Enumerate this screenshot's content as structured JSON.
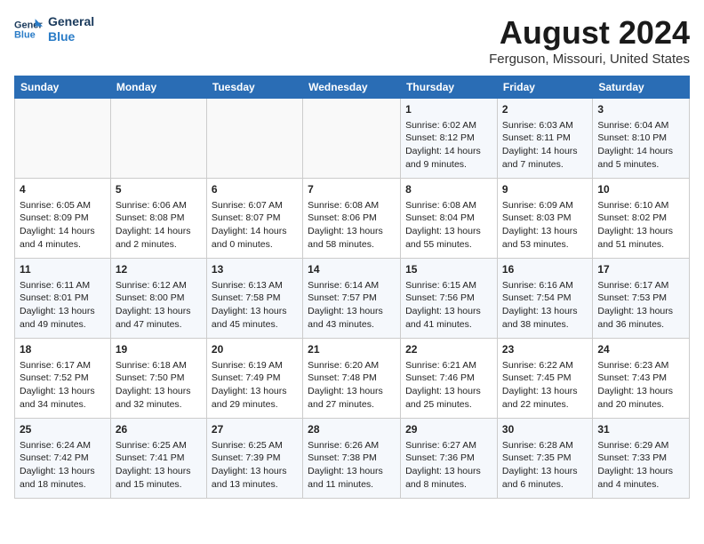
{
  "header": {
    "logo_line1": "General",
    "logo_line2": "Blue",
    "month_title": "August 2024",
    "location": "Ferguson, Missouri, United States"
  },
  "weekdays": [
    "Sunday",
    "Monday",
    "Tuesday",
    "Wednesday",
    "Thursday",
    "Friday",
    "Saturday"
  ],
  "weeks": [
    [
      {
        "day": "",
        "content": ""
      },
      {
        "day": "",
        "content": ""
      },
      {
        "day": "",
        "content": ""
      },
      {
        "day": "",
        "content": ""
      },
      {
        "day": "1",
        "content": "Sunrise: 6:02 AM\nSunset: 8:12 PM\nDaylight: 14 hours\nand 9 minutes."
      },
      {
        "day": "2",
        "content": "Sunrise: 6:03 AM\nSunset: 8:11 PM\nDaylight: 14 hours\nand 7 minutes."
      },
      {
        "day": "3",
        "content": "Sunrise: 6:04 AM\nSunset: 8:10 PM\nDaylight: 14 hours\nand 5 minutes."
      }
    ],
    [
      {
        "day": "4",
        "content": "Sunrise: 6:05 AM\nSunset: 8:09 PM\nDaylight: 14 hours\nand 4 minutes."
      },
      {
        "day": "5",
        "content": "Sunrise: 6:06 AM\nSunset: 8:08 PM\nDaylight: 14 hours\nand 2 minutes."
      },
      {
        "day": "6",
        "content": "Sunrise: 6:07 AM\nSunset: 8:07 PM\nDaylight: 14 hours\nand 0 minutes."
      },
      {
        "day": "7",
        "content": "Sunrise: 6:08 AM\nSunset: 8:06 PM\nDaylight: 13 hours\nand 58 minutes."
      },
      {
        "day": "8",
        "content": "Sunrise: 6:08 AM\nSunset: 8:04 PM\nDaylight: 13 hours\nand 55 minutes."
      },
      {
        "day": "9",
        "content": "Sunrise: 6:09 AM\nSunset: 8:03 PM\nDaylight: 13 hours\nand 53 minutes."
      },
      {
        "day": "10",
        "content": "Sunrise: 6:10 AM\nSunset: 8:02 PM\nDaylight: 13 hours\nand 51 minutes."
      }
    ],
    [
      {
        "day": "11",
        "content": "Sunrise: 6:11 AM\nSunset: 8:01 PM\nDaylight: 13 hours\nand 49 minutes."
      },
      {
        "day": "12",
        "content": "Sunrise: 6:12 AM\nSunset: 8:00 PM\nDaylight: 13 hours\nand 47 minutes."
      },
      {
        "day": "13",
        "content": "Sunrise: 6:13 AM\nSunset: 7:58 PM\nDaylight: 13 hours\nand 45 minutes."
      },
      {
        "day": "14",
        "content": "Sunrise: 6:14 AM\nSunset: 7:57 PM\nDaylight: 13 hours\nand 43 minutes."
      },
      {
        "day": "15",
        "content": "Sunrise: 6:15 AM\nSunset: 7:56 PM\nDaylight: 13 hours\nand 41 minutes."
      },
      {
        "day": "16",
        "content": "Sunrise: 6:16 AM\nSunset: 7:54 PM\nDaylight: 13 hours\nand 38 minutes."
      },
      {
        "day": "17",
        "content": "Sunrise: 6:17 AM\nSunset: 7:53 PM\nDaylight: 13 hours\nand 36 minutes."
      }
    ],
    [
      {
        "day": "18",
        "content": "Sunrise: 6:17 AM\nSunset: 7:52 PM\nDaylight: 13 hours\nand 34 minutes."
      },
      {
        "day": "19",
        "content": "Sunrise: 6:18 AM\nSunset: 7:50 PM\nDaylight: 13 hours\nand 32 minutes."
      },
      {
        "day": "20",
        "content": "Sunrise: 6:19 AM\nSunset: 7:49 PM\nDaylight: 13 hours\nand 29 minutes."
      },
      {
        "day": "21",
        "content": "Sunrise: 6:20 AM\nSunset: 7:48 PM\nDaylight: 13 hours\nand 27 minutes."
      },
      {
        "day": "22",
        "content": "Sunrise: 6:21 AM\nSunset: 7:46 PM\nDaylight: 13 hours\nand 25 minutes."
      },
      {
        "day": "23",
        "content": "Sunrise: 6:22 AM\nSunset: 7:45 PM\nDaylight: 13 hours\nand 22 minutes."
      },
      {
        "day": "24",
        "content": "Sunrise: 6:23 AM\nSunset: 7:43 PM\nDaylight: 13 hours\nand 20 minutes."
      }
    ],
    [
      {
        "day": "25",
        "content": "Sunrise: 6:24 AM\nSunset: 7:42 PM\nDaylight: 13 hours\nand 18 minutes."
      },
      {
        "day": "26",
        "content": "Sunrise: 6:25 AM\nSunset: 7:41 PM\nDaylight: 13 hours\nand 15 minutes."
      },
      {
        "day": "27",
        "content": "Sunrise: 6:25 AM\nSunset: 7:39 PM\nDaylight: 13 hours\nand 13 minutes."
      },
      {
        "day": "28",
        "content": "Sunrise: 6:26 AM\nSunset: 7:38 PM\nDaylight: 13 hours\nand 11 minutes."
      },
      {
        "day": "29",
        "content": "Sunrise: 6:27 AM\nSunset: 7:36 PM\nDaylight: 13 hours\nand 8 minutes."
      },
      {
        "day": "30",
        "content": "Sunrise: 6:28 AM\nSunset: 7:35 PM\nDaylight: 13 hours\nand 6 minutes."
      },
      {
        "day": "31",
        "content": "Sunrise: 6:29 AM\nSunset: 7:33 PM\nDaylight: 13 hours\nand 4 minutes."
      }
    ]
  ]
}
